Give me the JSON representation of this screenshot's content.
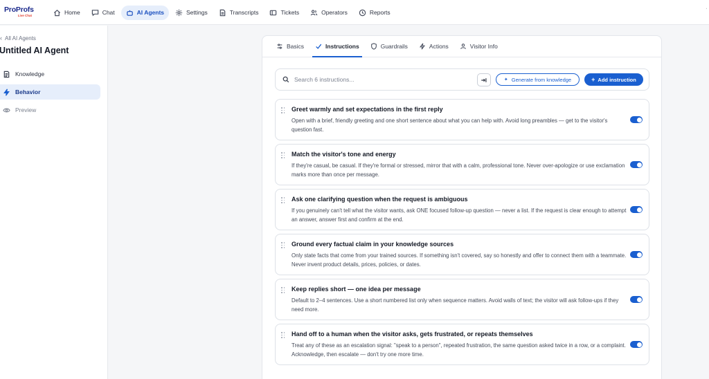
{
  "brand": {
    "name": "ProProfs",
    "sub": "Live Chat"
  },
  "nav": [
    {
      "label": "Home",
      "icon": "home-icon"
    },
    {
      "label": "Chat",
      "icon": "chat-icon"
    },
    {
      "label": "AI Agents",
      "icon": "robot-icon",
      "active": true
    },
    {
      "label": "Settings",
      "icon": "gear-icon"
    },
    {
      "label": "Transcripts",
      "icon": "document-icon"
    },
    {
      "label": "Tickets",
      "icon": "ticket-icon"
    },
    {
      "label": "Operators",
      "icon": "users-icon"
    },
    {
      "label": "Reports",
      "icon": "clock-icon"
    }
  ],
  "sidebar": {
    "back_label": "All AI Agents",
    "agent_title": "Untitled AI Agent",
    "items": [
      {
        "label": "Knowledge",
        "icon": "book-icon"
      },
      {
        "label": "Behavior",
        "icon": "bolt-icon",
        "active": true
      },
      {
        "label": "Preview",
        "icon": "eye-icon"
      }
    ]
  },
  "tabs": [
    {
      "label": "Basics",
      "icon": "sliders-icon"
    },
    {
      "label": "Instructions",
      "icon": "check-icon",
      "active": true
    },
    {
      "label": "Guardrails",
      "icon": "shield-icon"
    },
    {
      "label": "Actions",
      "icon": "bolt-icon"
    },
    {
      "label": "Visitor Info",
      "icon": "user-icon"
    }
  ],
  "toolbar": {
    "search_placeholder": "Search 6 instructions...",
    "generate_label": "Generate from knowledge",
    "add_label": "Add instruction"
  },
  "instructions": [
    {
      "title": "Greet warmly and set expectations in the first reply",
      "desc": "Open with a brief, friendly greeting and one short sentence about what you can help with. Avoid long preambles — get to the visitor's question fast.",
      "enabled": true
    },
    {
      "title": "Match the visitor's tone and energy",
      "desc": "If they're casual, be casual. If they're formal or stressed, mirror that with a calm, professional tone. Never over-apologize or use exclamation marks more than once per message.",
      "enabled": true
    },
    {
      "title": "Ask one clarifying question when the request is ambiguous",
      "desc": "If you genuinely can't tell what the visitor wants, ask ONE focused follow-up question — never a list. If the request is clear enough to attempt an answer, answer first and confirm at the end.",
      "enabled": true
    },
    {
      "title": "Ground every factual claim in your knowledge sources",
      "desc": "Only state facts that come from your trained sources. If something isn't covered, say so honestly and offer to connect them with a teammate. Never invent product details, prices, policies, or dates.",
      "enabled": true
    },
    {
      "title": "Keep replies short — one idea per message",
      "desc": "Default to 2–4 sentences. Use a short numbered list only when sequence matters. Avoid walls of text; the visitor will ask follow-ups if they need more.",
      "enabled": true
    },
    {
      "title": "Hand off to a human when the visitor asks, gets frustrated, or repeats themselves",
      "desc": "Treat any of these as an escalation signal: \"speak to a person\", repeated frustration, the same question asked twice in a row, or a complaint. Acknowledge, then escalate — don't try one more time.",
      "enabled": true
    }
  ],
  "colors": {
    "accent": "#1a5fd0",
    "active_bg": "#e6eefb",
    "brand": "#1b2a8c"
  }
}
